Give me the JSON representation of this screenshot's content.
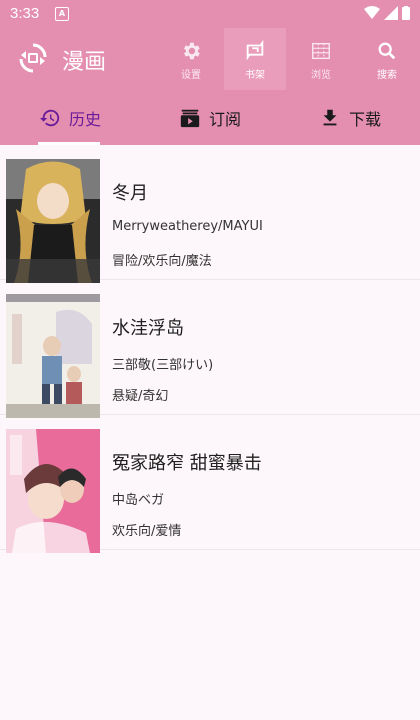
{
  "status_bar": {
    "time": "3:33",
    "notification_badge": "A"
  },
  "app_bar": {
    "title": "漫画",
    "actions": [
      {
        "label": "设置",
        "icon": "gear-icon"
      },
      {
        "label": "书架",
        "icon": "bookshelf-icon"
      },
      {
        "label": "浏览",
        "icon": "grid-browse-icon"
      },
      {
        "label": "搜索",
        "icon": "search-icon"
      }
    ]
  },
  "tabs": [
    {
      "label": "历史",
      "icon": "history-icon"
    },
    {
      "label": "订阅",
      "icon": "subscription-icon"
    },
    {
      "label": "下载",
      "icon": "download-icon"
    }
  ],
  "comics": [
    {
      "title": "冬月",
      "author": "Merryweatherey/MAYUI",
      "genres": "冒险/欢乐向/魔法"
    },
    {
      "title": "水洼浮岛",
      "author": "三部敬(三部けい)",
      "genres": "悬疑/奇幻"
    },
    {
      "title": "冤家路窄 甜蜜暴击",
      "author": "中岛ベガ",
      "genres": "欢乐向/爱情"
    }
  ],
  "colors": {
    "primary": "#e58fb0",
    "active_tab": "#6a1b9a",
    "background": "#fdf6fa"
  }
}
